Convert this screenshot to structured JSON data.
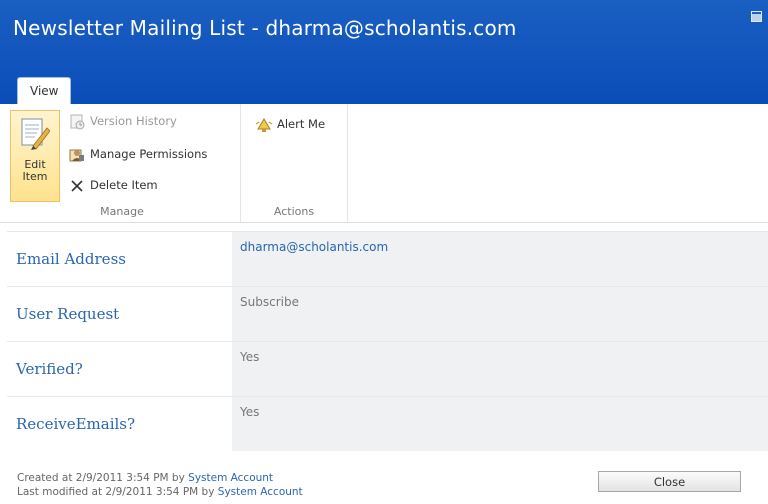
{
  "window": {
    "title": "Newsletter Mailing List - dharma@scholantis.com",
    "tabs": [
      "View"
    ]
  },
  "ribbon": {
    "manage": {
      "edit_item": [
        "Edit",
        "Item"
      ],
      "version_history": "Version History",
      "manage_permissions": "Manage Permissions",
      "delete_item": "Delete Item",
      "group_label": "Manage"
    },
    "actions": {
      "alert_me": "Alert Me",
      "group_label": "Actions"
    }
  },
  "fields": [
    {
      "label": "Email Address",
      "value": "dharma@scholantis.com",
      "value_is_link": true
    },
    {
      "label": "User Request",
      "value": "Subscribe",
      "value_is_link": false
    },
    {
      "label": "Verified?",
      "value": "Yes",
      "value_is_link": false
    },
    {
      "label": "ReceiveEmails?",
      "value": "Yes",
      "value_is_link": false
    }
  ],
  "footer": {
    "created_prefix": "Created at 2/9/2011 3:54 PM by",
    "created_by": "System Account",
    "modified_prefix": "Last modified at 2/9/2011 3:54 PM by",
    "modified_by": "System Account",
    "close_label": "Close"
  },
  "colors": {
    "title_bar": "#0b4db8",
    "link": "#2a66b0",
    "edit_highlight": "#ffe28d",
    "value_background": "#eff1f3"
  },
  "icons": {
    "edit_item": "edit-document-icon",
    "version_history": "version-history-icon",
    "manage_permissions": "permissions-icon",
    "delete_item": "delete-x-icon",
    "alert_me": "alert-bell-icon",
    "window_control": "maximize-icon"
  }
}
